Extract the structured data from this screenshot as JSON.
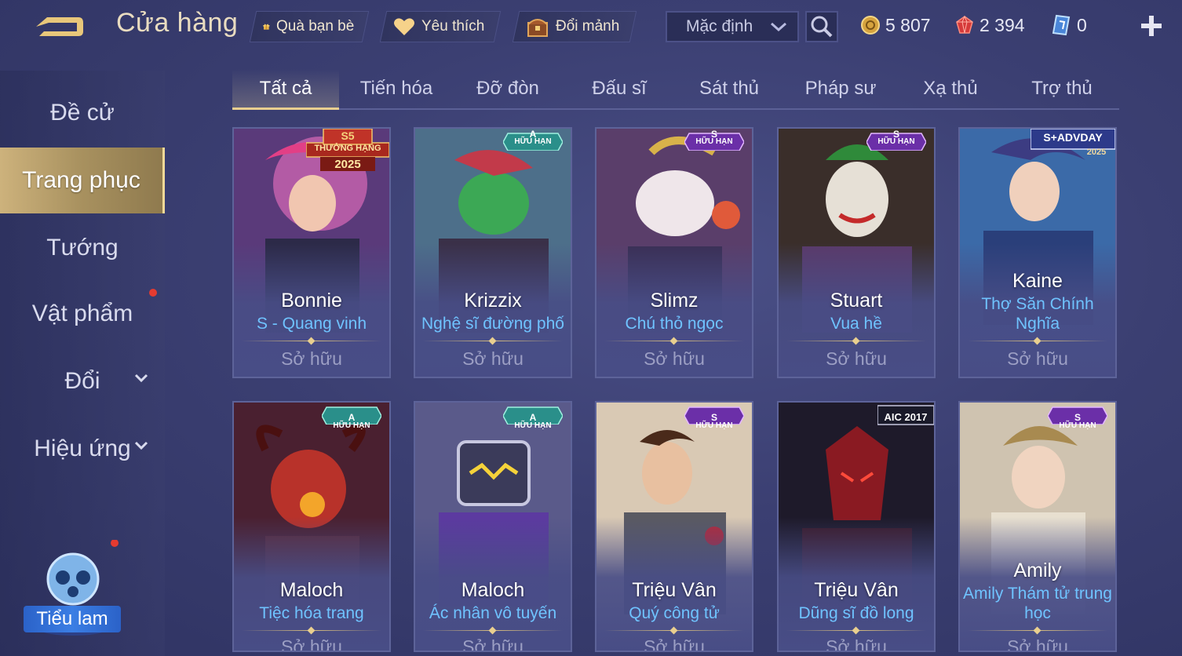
{
  "header": {
    "title": "Cửa hàng",
    "gift_label": "Quà bạn bè",
    "favorite_label": "Yêu thích",
    "exchange_label": "Đổi mảnh",
    "sort_value": "Mặc định",
    "gold": "5 807",
    "gems": "2 394",
    "vouchers": "0"
  },
  "sidebar": {
    "items": [
      {
        "label": "Đề cử"
      },
      {
        "label": "Trang phục"
      },
      {
        "label": "Tướng"
      },
      {
        "label": "Vật phẩm"
      },
      {
        "label": "Đổi"
      },
      {
        "label": "Hiệu ứng"
      }
    ],
    "assistant_label": "Tiểu lam"
  },
  "tabs": [
    "Tất cả",
    "Tiến hóa",
    "Đỡ đòn",
    "Đấu sĩ",
    "Sát thủ",
    "Pháp sư",
    "Xạ thủ",
    "Trợ thủ"
  ],
  "badges": {
    "limited": "HỮU HẠN",
    "rank_reward": "THƯỞNG HẠNG",
    "year": "2025",
    "rank_s": "S5",
    "event_aic": "AIC 2017",
    "event_advday": "S+ADVDAY",
    "event_advday_year": "2025"
  },
  "cards": [
    {
      "hero": "Bonnie",
      "skin": "S - Quang vinh",
      "status": "Sở hữu",
      "tier": ""
    },
    {
      "hero": "Krizzix",
      "skin": "Nghệ sĩ đường phố",
      "status": "Sở hữu",
      "tier": "A"
    },
    {
      "hero": "Slimz",
      "skin": "Chú thỏ ngọc",
      "status": "Sở hữu",
      "tier": "S"
    },
    {
      "hero": "Stuart",
      "skin": "Vua hề",
      "status": "Sở hữu",
      "tier": "S"
    },
    {
      "hero": "Kaine",
      "skin": "Thợ Săn Chính Nghĩa",
      "status": "Sở hữu",
      "tier": ""
    },
    {
      "hero": "Maloch",
      "skin": "Tiệc hóa trang",
      "status": "Sở hữu",
      "tier": "A"
    },
    {
      "hero": "Maloch",
      "skin": "Ác nhân vô tuyến",
      "status": "Sở hữu",
      "tier": "A"
    },
    {
      "hero": "Triệu Vân",
      "skin": "Quý công tử",
      "status": "Sở hữu",
      "tier": "S"
    },
    {
      "hero": "Triệu Vân",
      "skin": "Dũng sĩ đồ long",
      "status": "Sở hữu",
      "tier": ""
    },
    {
      "hero": "Amily",
      "skin": "Amily Thám tử trung học",
      "status": "Sở hữu",
      "tier": "S"
    }
  ],
  "colors": {
    "accent_gold": "#e9cf8f",
    "skin_name_blue": "#6fc3ff",
    "active_tab_gold": "#cdb27c",
    "notification_red": "#e53b30"
  }
}
